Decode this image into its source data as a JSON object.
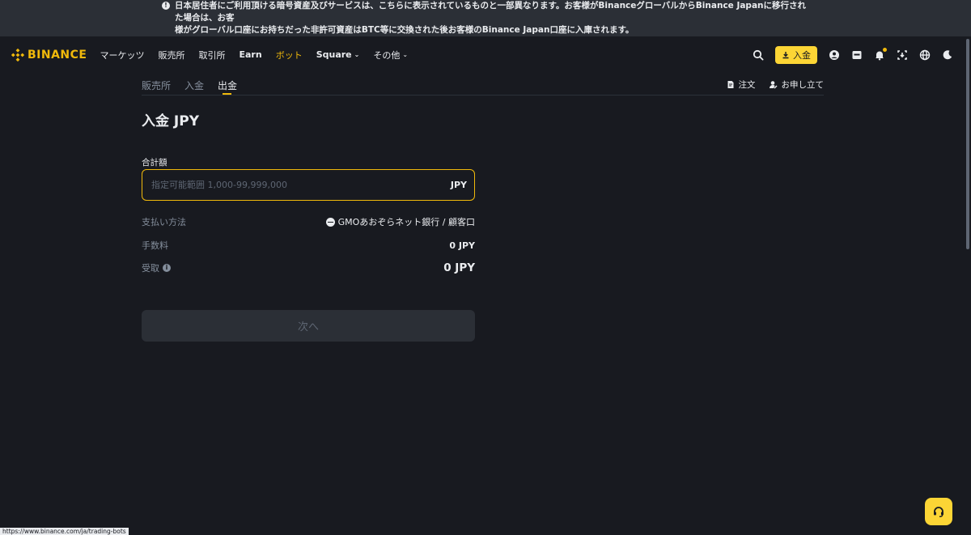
{
  "notice": {
    "line1": "日本居住者にご利用頂ける暗号資産及びサービスは、こちらに表示されているものと一部異なります。お客様がBinanceグローバルからBinance Japanに移行された場合は、お客",
    "line2": "様がグローバル口座にお持ちだった非許可資産はBTC等に交換された後お客様のBinance Japan口座に入庫されます。"
  },
  "header": {
    "logo_text": "BINANCE",
    "nav": [
      "マーケッツ",
      "販売所",
      "取引所",
      "Earn",
      "ボット",
      "Square",
      "その他"
    ],
    "deposit_label": "入金"
  },
  "subnav": {
    "tabs": [
      "販売所",
      "入金",
      "出金"
    ],
    "orders_label": "注文",
    "claim_label": "お申し立て"
  },
  "form": {
    "title": "入金 JPY",
    "amount_label": "合計額",
    "amount_placeholder": "指定可能範囲 1,000-99,999,000",
    "amount_unit": "JPY",
    "payment_label": "支払い方法",
    "payment_value": "GMOあおぞらネット銀行 / 顧客口",
    "fee_label": "手数料",
    "fee_value": "0 JPY",
    "receive_label": "受取",
    "receive_value": "0 JPY",
    "next_label": "次へ"
  },
  "status_url": "https://www.binance.com/ja/trading-bots",
  "colors": {
    "accent": "#f0b90b",
    "background": "#181a20",
    "button_yellow": "#fcd535"
  }
}
